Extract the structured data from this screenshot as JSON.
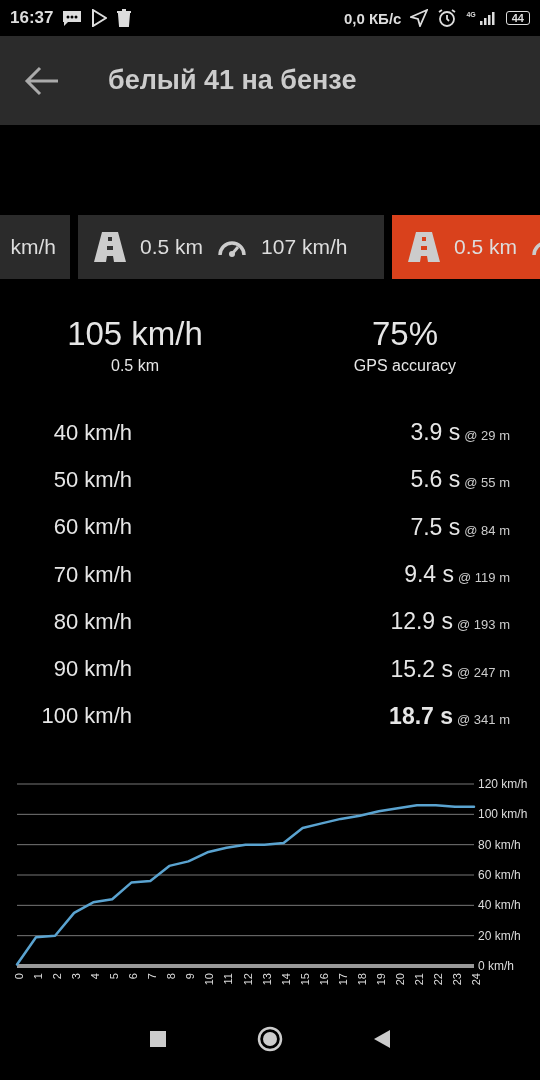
{
  "status_bar": {
    "time": "16:37",
    "network_speed": "0,0 КБ/с",
    "network_type": "4G",
    "battery": "44"
  },
  "toolbar": {
    "title": "белый 41 на бензе"
  },
  "runs": [
    {
      "selected": false,
      "speed": "km/h"
    },
    {
      "selected": false,
      "distance": "0.5 km",
      "speed": "107 km/h"
    },
    {
      "selected": true,
      "distance": "0.5 km"
    }
  ],
  "summary": [
    {
      "value": "105 km/h",
      "caption": "0.5 km"
    },
    {
      "value": "75%",
      "caption": "GPS accuracy"
    }
  ],
  "splits": [
    {
      "speed": "40 km/h",
      "time": "3.9 s",
      "distance": "@ 29 m",
      "highlight": false
    },
    {
      "speed": "50 km/h",
      "time": "5.6 s",
      "distance": "@ 55 m",
      "highlight": false
    },
    {
      "speed": "60 km/h",
      "time": "7.5 s",
      "distance": "@ 84 m",
      "highlight": false
    },
    {
      "speed": "70 km/h",
      "time": "9.4 s",
      "distance": "@ 119 m",
      "highlight": false
    },
    {
      "speed": "80 km/h",
      "time": "12.9 s",
      "distance": "@ 193 m",
      "highlight": false
    },
    {
      "speed": "90 km/h",
      "time": "15.2 s",
      "distance": "@ 247 m",
      "highlight": false
    },
    {
      "speed": "100 km/h",
      "time": "18.7 s",
      "distance": "@ 341 m",
      "highlight": true
    }
  ],
  "chart_data": {
    "type": "line",
    "x": [
      0,
      1,
      2,
      3,
      4,
      5,
      6,
      7,
      8,
      9,
      10,
      11,
      12,
      13,
      14,
      15,
      16,
      17,
      18,
      19,
      20,
      21,
      22,
      23,
      24
    ],
    "grid": true,
    "series": [
      {
        "color": "#5aa3d0",
        "values": [
          1,
          19,
          20,
          35,
          42,
          44,
          55,
          56,
          66,
          69,
          75,
          78,
          80,
          80,
          81,
          91,
          94,
          97,
          99,
          102,
          104,
          106,
          106,
          105,
          105
        ]
      }
    ],
    "xlim": [
      0,
      24
    ],
    "ylim": [
      0,
      120
    ],
    "xticks": [
      0,
      1,
      2,
      3,
      4,
      5,
      6,
      7,
      8,
      9,
      10,
      11,
      12,
      13,
      14,
      15,
      16,
      17,
      18,
      19,
      20,
      21,
      22,
      23,
      24
    ],
    "yticks": [
      {
        "value": 0,
        "label": "0 km/h"
      },
      {
        "value": 20,
        "label": "20 km/h"
      },
      {
        "value": 40,
        "label": "40 km/h"
      },
      {
        "value": 60,
        "label": "60 km/h"
      },
      {
        "value": 80,
        "label": "80 km/h"
      },
      {
        "value": 100,
        "label": "100 km/h"
      },
      {
        "value": 120,
        "label": "120 km/h"
      }
    ]
  }
}
